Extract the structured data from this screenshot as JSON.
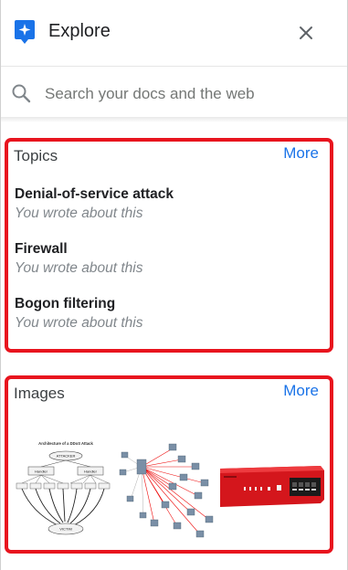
{
  "header": {
    "title": "Explore",
    "icons": {
      "app": "explore-icon",
      "close": "close-icon"
    }
  },
  "search": {
    "placeholder": "Search your docs and the web",
    "value": "",
    "icon": "search-icon"
  },
  "topics": {
    "heading": "Topics",
    "more_label": "More",
    "items": [
      {
        "name": "Denial-of-service attack",
        "subtitle": "You wrote about this"
      },
      {
        "name": "Firewall",
        "subtitle": "You wrote about this"
      },
      {
        "name": "Bogon filtering",
        "subtitle": "You wrote about this"
      }
    ]
  },
  "images": {
    "heading": "Images",
    "more_label": "More",
    "thumbnails": [
      {
        "kind": "ddos-diagram",
        "caption": "Architecture of a DDoS Attack",
        "labels": {
          "attacker": "ATTACKER",
          "handler": "Handler",
          "victim": "VICTIM"
        }
      },
      {
        "kind": "network-diagram"
      },
      {
        "kind": "firewall-appliance"
      }
    ]
  },
  "colors": {
    "accent_blue": "#1a73e8",
    "highlight_red": "#e8141e",
    "muted_text": "#80868b"
  }
}
